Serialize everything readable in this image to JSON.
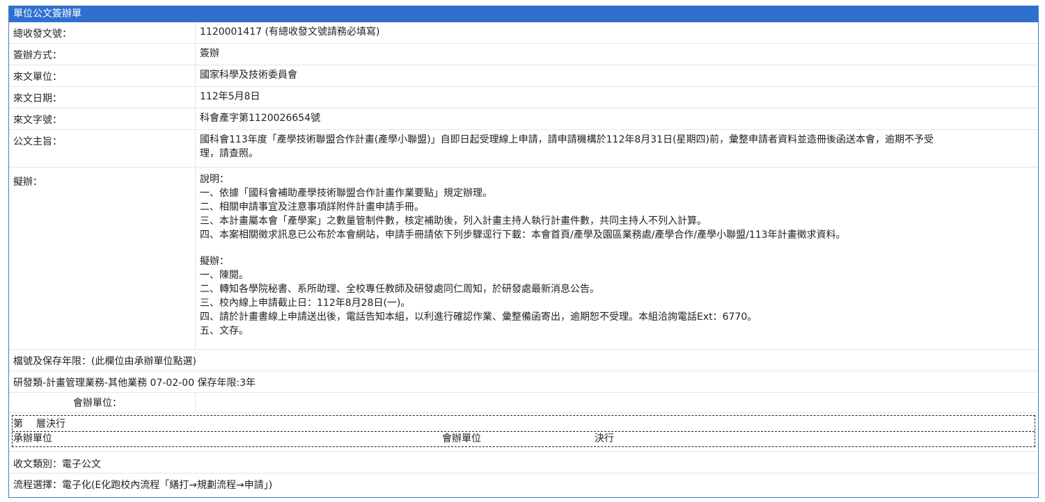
{
  "form": {
    "title": "單位公文簽辦單",
    "fields": [
      {
        "label": "總收發文號：",
        "value": "1120001417 (有總收發文號請務必填寫)"
      },
      {
        "label": "簽辦方式：",
        "value": "簽辦"
      },
      {
        "label": "來文單位：",
        "value": "國家科學及技術委員會"
      },
      {
        "label": "來文日期：",
        "value": "112年5月8日"
      },
      {
        "label": "來文字號：",
        "value": "科會產字第1120026654號"
      }
    ],
    "subject": {
      "label": "公文主旨：",
      "lines": [
        "國科會113年度「產學技術聯盟合作計畫(產學小聯盟)」自即日起受理線上申請，請申請機構於112年8月31日(星期四)前，彙整申請者資料並造冊後函送本會，逾期不予受",
        "理，請查照。"
      ]
    },
    "proposal": {
      "label": "擬辦：",
      "explain_lines": [
        "說明：",
        "一、依據「國科會補助產學技術聯盟合作計畫作業要點」規定辦理。",
        "二、相關申請事宜及注意事項詳附件計畫申請手冊。",
        "三、本計畫屬本會「產學案」之數量管制件數，核定補助後，列入計畫主持人執行計畫件數，共同主持人不列入計算。",
        "四、本案相關徵求訊息已公布於本會網站，申請手冊請依下列步驟逕行下載：本會首頁/產學及園區業務處/產學合作/產學小聯盟/113年計畫徵求資料。"
      ],
      "plan_lines": [
        "擬辦：",
        "一、陳閱。",
        "二、轉知各學院秘書、系所助理、全校專任教師及研發處同仁周知，於研發處最新消息公告。",
        "三、校內線上申請截止日：112年8月28日(一)。",
        "四、請於計畫書線上申請送出後，電話告知本組，以利進行確認作業、彙整備函寄出，逾期恕不受理。本組洽詢電話Ext：6770。",
        "五、文存。"
      ]
    },
    "archive_label": "檔號及保存年限：(此欄位由承辦單位點選)",
    "archive_value": "研發類-計畫管理業務-其他業務 07-02-00 保存年限:3年",
    "cosign_label": "會辦單位：",
    "cosign_value": "",
    "decision": {
      "level_prefix": "第",
      "level_suffix": "層決行",
      "handling_unit": "承辦單位",
      "cosign_unit": "會辦單位",
      "decide": "決行"
    },
    "doc_type": "收文類別：電子公文",
    "flow": "流程選擇：電子化(E化跑校內流程「繕打→規劃流程→申請」)"
  }
}
